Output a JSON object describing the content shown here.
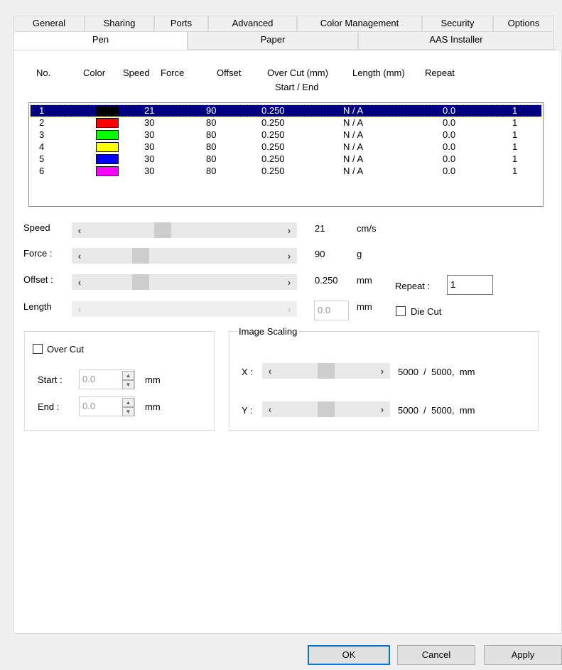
{
  "tabs_row1": [
    "General",
    "Sharing",
    "Ports",
    "Advanced",
    "Color Management",
    "Security",
    "Options"
  ],
  "tabs_row2": [
    "Pen",
    "Paper",
    "AAS Installer"
  ],
  "table_header": {
    "no": "No.",
    "color": "Color",
    "speed": "Speed",
    "force": "Force",
    "offset": "Offset",
    "overcut": "Over Cut (mm)",
    "overcut_sub": "Start / End",
    "length": "Length (mm)",
    "repeat": "Repeat"
  },
  "pens": [
    {
      "no": "1",
      "color": "#000000",
      "speed": "21",
      "force": "90",
      "offset": "0.250",
      "overcut": "N / A",
      "length": "0.0",
      "repeat": "1",
      "selected": true
    },
    {
      "no": "2",
      "color": "#ff0000",
      "speed": "30",
      "force": "80",
      "offset": "0.250",
      "overcut": "N / A",
      "length": "0.0",
      "repeat": "1"
    },
    {
      "no": "3",
      "color": "#00ff00",
      "speed": "30",
      "force": "80",
      "offset": "0.250",
      "overcut": "N / A",
      "length": "0.0",
      "repeat": "1"
    },
    {
      "no": "4",
      "color": "#ffff00",
      "speed": "30",
      "force": "80",
      "offset": "0.250",
      "overcut": "N / A",
      "length": "0.0",
      "repeat": "1"
    },
    {
      "no": "5",
      "color": "#0000ff",
      "speed": "30",
      "force": "80",
      "offset": "0.250",
      "overcut": "N / A",
      "length": "0.0",
      "repeat": "1"
    },
    {
      "no": "6",
      "color": "#ff00ff",
      "speed": "30",
      "force": "80",
      "offset": "0.250",
      "overcut": "N / A",
      "length": "0.0",
      "repeat": "1"
    }
  ],
  "controls": {
    "speed": {
      "label": "Speed",
      "value": "21",
      "unit": "cm/s"
    },
    "force": {
      "label": "Force :",
      "value": "90",
      "unit": "g"
    },
    "offset": {
      "label": "Offset :",
      "value": "0.250",
      "unit": "mm"
    },
    "length": {
      "label": "Length",
      "value": "0.0",
      "unit": "mm"
    },
    "repeat": {
      "label": "Repeat :",
      "value": "1"
    },
    "die_cut": {
      "label": "Die Cut",
      "checked": false
    }
  },
  "over_cut": {
    "label": "Over Cut",
    "checked": false,
    "start_label": "Start :",
    "start_value": "0.0",
    "end_label": "End :",
    "end_value": "0.0",
    "unit": "mm"
  },
  "image_scaling": {
    "title": "Image Scaling",
    "x_label": "X :",
    "x_value": "5000  /  5000,  mm",
    "y_label": "Y :",
    "y_value": "5000  /  5000,  mm"
  },
  "buttons": {
    "ok": "OK",
    "cancel": "Cancel",
    "apply": "Apply"
  }
}
